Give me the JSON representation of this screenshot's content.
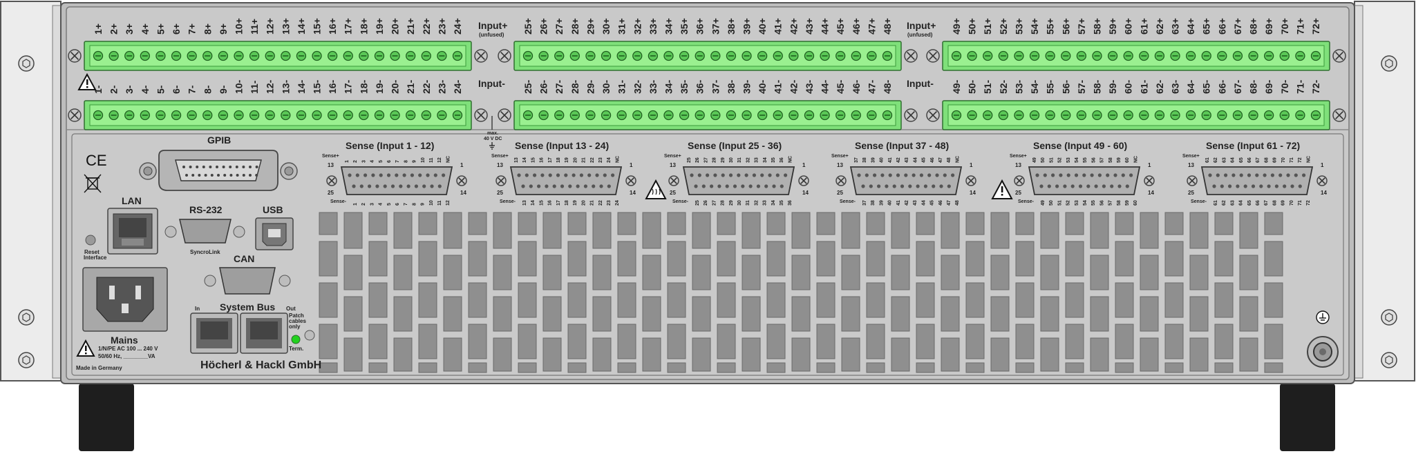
{
  "device": {
    "manufacturer": "Höcherl & Hackl GmbH",
    "made_in": "Made in Germany"
  },
  "terminals": {
    "input_plus_label": "Input+",
    "input_minus_label": "Input-",
    "unfused_note": "(unfused)",
    "max_voltage_line1": "max.",
    "max_voltage_line2": "40 V DC",
    "blocks": [
      {
        "plus": [
          "1+",
          "2+",
          "3+",
          "4+",
          "5+",
          "6+",
          "7+",
          "8+",
          "9+",
          "10+",
          "11+",
          "12+",
          "13+",
          "14+",
          "15+",
          "16+",
          "17+",
          "18+",
          "19+",
          "20+",
          "21+",
          "22+",
          "23+",
          "24+"
        ],
        "minus": [
          "1-",
          "2-",
          "3-",
          "4-",
          "5-",
          "6-",
          "7-",
          "8-",
          "9-",
          "10-",
          "11-",
          "12-",
          "13-",
          "14-",
          "15-",
          "16-",
          "17-",
          "18-",
          "19-",
          "20-",
          "21-",
          "22-",
          "23-",
          "24-"
        ]
      },
      {
        "plus": [
          "25+",
          "26+",
          "27+",
          "28+",
          "29+",
          "30+",
          "31+",
          "32+",
          "33+",
          "34+",
          "35+",
          "36+",
          "37+",
          "38+",
          "39+",
          "40+",
          "41+",
          "42+",
          "43+",
          "44+",
          "45+",
          "46+",
          "47+",
          "48+"
        ],
        "minus": [
          "25-",
          "26-",
          "27-",
          "28-",
          "29-",
          "30-",
          "31-",
          "32-",
          "33-",
          "34-",
          "35-",
          "36-",
          "37-",
          "38-",
          "39-",
          "40-",
          "41-",
          "42-",
          "43-",
          "44-",
          "45-",
          "46-",
          "47-",
          "48-"
        ]
      },
      {
        "plus": [
          "49+",
          "50+",
          "51+",
          "52+",
          "53+",
          "54+",
          "55+",
          "56+",
          "57+",
          "58+",
          "59+",
          "60+",
          "61+",
          "62+",
          "63+",
          "64+",
          "65+",
          "66+",
          "67+",
          "68+",
          "69+",
          "70+",
          "71+",
          "72+"
        ],
        "minus": [
          "49-",
          "50-",
          "51-",
          "52-",
          "53-",
          "54-",
          "55-",
          "56-",
          "57-",
          "58-",
          "59-",
          "60-",
          "61-",
          "62-",
          "63-",
          "64-",
          "65-",
          "66-",
          "67-",
          "68-",
          "69-",
          "70-",
          "71-",
          "72-"
        ]
      }
    ]
  },
  "ports": {
    "gpib": "GPIB",
    "lan": "LAN",
    "reset_line1": "Reset",
    "reset_line2": "Interface",
    "rs232": "RS-232",
    "syncrolink": "SyncroLink",
    "usb": "USB",
    "can": "CAN",
    "system_bus": "System Bus",
    "in": "In",
    "out": "Out",
    "patch_line1": "Patch",
    "patch_line2": "cables",
    "patch_line3": "only",
    "term": "Term.",
    "ce_mark": "CE"
  },
  "mains": {
    "title": "Mains",
    "line1": "1/N/PE AC 100 ... 240 V",
    "line2": "50/60 Hz, ________VA"
  },
  "sense": {
    "plus_label": "Sense+",
    "minus_label": "Sense-",
    "nc_label": "NC",
    "pin_corners": [
      "13",
      "1",
      "25",
      "14"
    ],
    "connectors": [
      {
        "title": "Sense (Input 1 - 12)",
        "top": [
          "1",
          "2",
          "3",
          "4",
          "5",
          "6",
          "7",
          "8",
          "9",
          "10",
          "11",
          "12"
        ],
        "bottom": [
          "1",
          "2",
          "3",
          "4",
          "5",
          "6",
          "7",
          "8",
          "9",
          "10",
          "11",
          "12"
        ]
      },
      {
        "title": "Sense (Input 13 - 24)",
        "top": [
          "13",
          "14",
          "15",
          "16",
          "17",
          "18",
          "19",
          "20",
          "21",
          "22",
          "23",
          "24"
        ],
        "bottom": [
          "13",
          "14",
          "15",
          "16",
          "17",
          "18",
          "19",
          "20",
          "21",
          "22",
          "23",
          "24"
        ]
      },
      {
        "title": "Sense (Input 25 - 36)",
        "top": [
          "25",
          "26",
          "27",
          "28",
          "29",
          "30",
          "31",
          "32",
          "33",
          "34",
          "35",
          "36"
        ],
        "bottom": [
          "25",
          "26",
          "27",
          "28",
          "29",
          "30",
          "31",
          "32",
          "33",
          "34",
          "35",
          "36"
        ]
      },
      {
        "title": "Sense (Input 37 - 48)",
        "top": [
          "37",
          "38",
          "39",
          "40",
          "41",
          "42",
          "43",
          "44",
          "45",
          "46",
          "47",
          "48"
        ],
        "bottom": [
          "37",
          "38",
          "39",
          "40",
          "41",
          "42",
          "43",
          "44",
          "45",
          "46",
          "47",
          "48"
        ]
      },
      {
        "title": "Sense (Input 49 - 60)",
        "top": [
          "49",
          "50",
          "51",
          "52",
          "53",
          "54",
          "55",
          "56",
          "57",
          "58",
          "59",
          "60"
        ],
        "bottom": [
          "49",
          "50",
          "51",
          "52",
          "53",
          "54",
          "55",
          "56",
          "57",
          "58",
          "59",
          "60"
        ]
      },
      {
        "title": "Sense (Input 61 - 72)",
        "top": [
          "61",
          "62",
          "63",
          "64",
          "65",
          "66",
          "67",
          "68",
          "69",
          "70",
          "71",
          "72"
        ],
        "bottom": [
          "61",
          "62",
          "63",
          "64",
          "65",
          "66",
          "67",
          "68",
          "69",
          "70",
          "71",
          "72"
        ]
      }
    ]
  },
  "icons": [
    "warning-icon",
    "hot-surface-icon",
    "ce-mark-icon",
    "weee-bin-icon",
    "ground-icon",
    "screw-icon"
  ],
  "colors": {
    "panel": "#c9c9c9",
    "vent_panel": "#d0d0d0",
    "vent_slot": "#8f8f8f",
    "terminal_green": "#7fe07a",
    "terminal_dark": "#3aa83a",
    "rack_ear": "#ececec",
    "foot": "#1e1e1e",
    "led": "#22d11e"
  }
}
